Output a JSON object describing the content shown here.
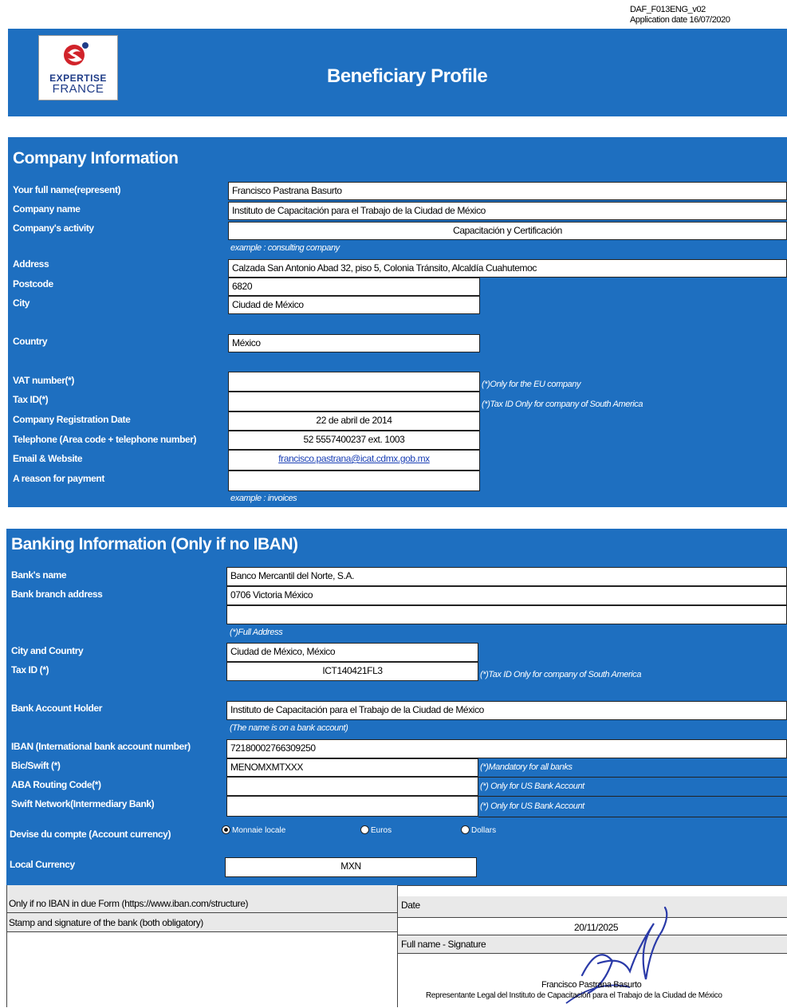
{
  "doc": {
    "code": "DAF_F013ENG_v02",
    "application_date": "Application date 16/07/2020"
  },
  "logo": {
    "line1": "EXPERTISE",
    "line2": "FRANCE"
  },
  "title": "Beneficiary Profile",
  "company": {
    "header": "Company Information",
    "full_name": {
      "label": "Your full name(represent)",
      "value": "Francisco Pastrana Basurto"
    },
    "company_name": {
      "label": "Company name",
      "value": "Instituto de Capacitación para el Trabajo de la Ciudad de México"
    },
    "activity": {
      "label": "Company's activity",
      "value": "Capacitación y Certificación",
      "example": "example : consulting company"
    },
    "address": {
      "label": "Address",
      "value": "Calzada San Antonio Abad 32, piso 5, Colonia Tránsito, Alcaldía Cuahutemoc"
    },
    "postcode": {
      "label": "Postcode",
      "value": "6820"
    },
    "city": {
      "label": "City",
      "value": "Ciudad de México"
    },
    "country": {
      "label": "Country",
      "value": "México"
    },
    "vat": {
      "label": "VAT number(*)",
      "value": "",
      "note": "(*)Only for the EU company"
    },
    "tax_id": {
      "label": "Tax ID(*)",
      "value": "",
      "note": "(*)Tax ID Only for company of South America"
    },
    "reg_date": {
      "label": "Company Registration Date",
      "value": "22 de abril de 2014"
    },
    "telephone": {
      "label": "Telephone (Area code + telephone number)",
      "value": "52 5557400237  ext. 1003"
    },
    "email": {
      "label": "Email & Website",
      "value": "francisco.pastrana@icat.cdmx.gob.mx"
    },
    "reason": {
      "label": "A reason for payment",
      "value": "",
      "example": "example : invoices"
    }
  },
  "banking": {
    "header": "Banking Information (Only if no IBAN)",
    "bank_name": {
      "label": "Bank's name",
      "value": "Banco Mercantil del Norte, S.A."
    },
    "branch": {
      "label": "Bank branch address",
      "value": "0706 Victoria México",
      "value2": "",
      "note": "(*)Full Address"
    },
    "city_country": {
      "label": "City and Country",
      "value": "Ciudad de México, México"
    },
    "tax_id": {
      "label": "Tax ID (*)",
      "value": "ICT140421FL3",
      "note": "(*)Tax ID Only for company of South America"
    },
    "holder": {
      "label": "Bank Account Holder",
      "value": "Instituto de Capacitación para el Trabajo de la Ciudad de México",
      "note": "(The name is on a bank account)"
    },
    "iban": {
      "label": "IBAN (International bank account number)",
      "value": "72180002766309250"
    },
    "bic": {
      "label": "Bic/Swift (*)",
      "value": "MENOMXMTXXX",
      "note": "(*)Mandatory for all banks"
    },
    "aba": {
      "label": "ABA Routing Code(*)",
      "value": "",
      "note": "(*) Only for US Bank Account"
    },
    "swift_network": {
      "label": "Swift Network(Intermediary Bank)",
      "value": "",
      "note": "(*) Only for US Bank Account"
    },
    "currency": {
      "label": "Devise du compte (Account currency)",
      "options": [
        "Monnaie locale",
        "Euros",
        "Dollars"
      ],
      "selected": "Monnaie locale"
    },
    "local_currency": {
      "label": "Local Currency",
      "value": "MXN"
    }
  },
  "footer": {
    "iban_note": "Only if no IBAN in due Form (https://www.iban.com/structure)",
    "stamp_label": "Stamp and signature of the bank (both obligatory)",
    "date_label": "Date",
    "date_value": "20/11/2025",
    "signature_label": "Full name - Signature",
    "signer_name": "Francisco Pastrana Basurto",
    "signer_role": "Representante Legal del Instituto de Capacitación para el Trabajo de la Ciudad de México"
  }
}
